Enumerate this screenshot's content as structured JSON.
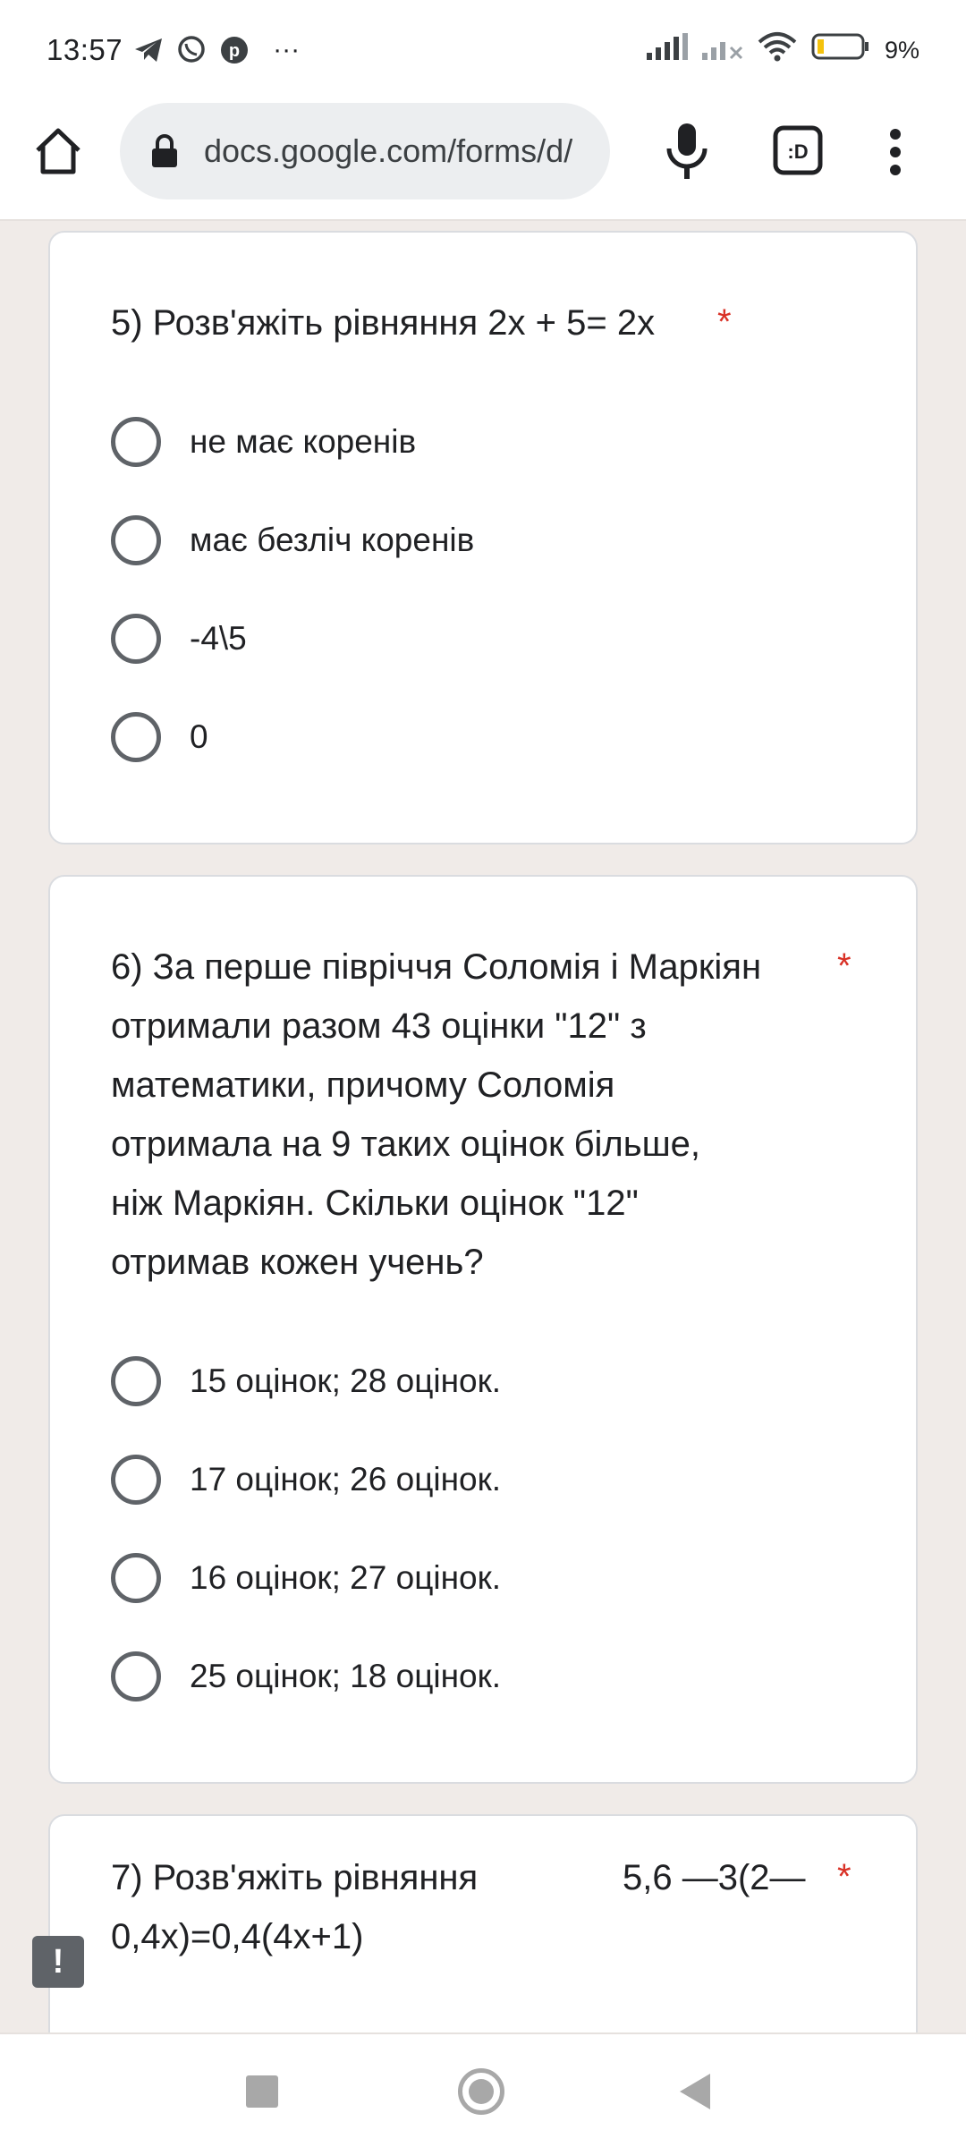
{
  "status_bar": {
    "time": "13:57",
    "more_indicator": "···",
    "battery": "9%"
  },
  "browser": {
    "url": "docs.google.com/forms/d/"
  },
  "questions": [
    {
      "title": "5) Розв'яжіть рівняння  2x + 5= 2x",
      "required_mark": "*",
      "options": [
        "не має коренів",
        "має безліч коренів",
        "-4\\5",
        "0"
      ]
    },
    {
      "title_lines": [
        "6) За перше півріччя Соломія і Маркіян",
        "отримали разом 43 оцінки \"12\" з",
        "математики, причому Соломія",
        "отримала на 9 таких оцінок більше,",
        "ніж Маркіян. Скільки оцінок \"12\"",
        "отримав кожен учень?"
      ],
      "required_mark": "*",
      "options": [
        "15 оцінок; 28 оцінок.",
        "17 оцінок; 26 оцінок.",
        "16 оцінок; 27 оцінок.",
        "25 оцінок; 18 оцінок."
      ]
    },
    {
      "title_lines": [
        "7) Розв'яжіть рівняння",
        "0,4x)=0,4(4x+1)"
      ],
      "title_right": "5,6 —3(2—",
      "required_mark": "*"
    }
  ],
  "feedback_icon": "!"
}
